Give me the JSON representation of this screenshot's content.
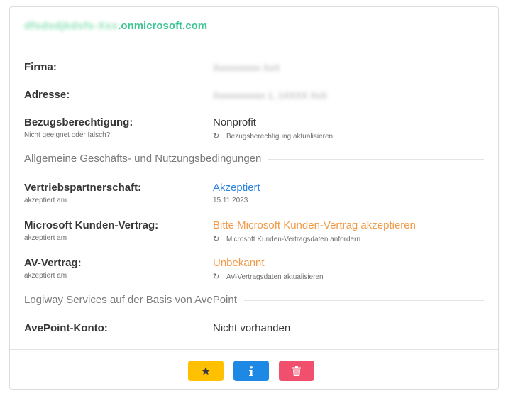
{
  "header": {
    "domain_hidden": "dfsdsdjkdsfs-Xxx",
    "domain_suffix": ".onmicrosoft.com"
  },
  "fields": {
    "firma": {
      "label": "Firma:",
      "value_hidden": "Xxxxxxxxxx XxX"
    },
    "adresse": {
      "label": "Adresse:",
      "value_hidden": "Xxxxxxxxxxx 1, 1XXXX XxX"
    },
    "bezug": {
      "label": "Bezugsberechtigung:",
      "sub": "Nicht geeignet oder falsch?",
      "value": "Nonprofit",
      "action": "Bezugsberechtigung aktualisieren"
    }
  },
  "section1": {
    "title": "Allgemeine Geschäfts- und Nutzungsbedingungen"
  },
  "terms": {
    "vertrieb": {
      "label": "Vertriebspartnerschaft:",
      "sub": "akzeptiert am",
      "value": "Akzeptiert",
      "date": "15.11.2023"
    },
    "mkv": {
      "label": "Microsoft Kunden-Vertrag:",
      "sub": "akzeptiert am",
      "value": "Bitte Microsoft Kunden-Vertrag akzeptieren",
      "action": "Microsoft Kunden-Vertragsdaten anfordern"
    },
    "av": {
      "label": "AV-Vertrag:",
      "sub": "akzeptiert am",
      "value": "Unbekannt",
      "action": "AV-Vertragsdaten aktualisieren"
    }
  },
  "section2": {
    "title": "Logiway Services auf der Basis von AvePoint"
  },
  "avepoint": {
    "label": "AvePoint-Konto:",
    "value": "Nicht vorhanden"
  },
  "footer": {
    "colors": {
      "star_button": "#ffc000",
      "info_button": "#1e88e5",
      "delete_button": "#f0506e"
    },
    "icons": {
      "star": "star-icon",
      "info": "info-icon",
      "delete": "trash-icon"
    }
  },
  "colors": {
    "header_accent": "#3cc492",
    "link_blue": "#2e86de",
    "warning_orange": "#f39a48"
  }
}
